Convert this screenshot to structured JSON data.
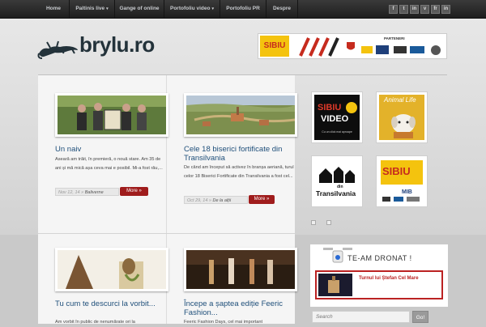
{
  "nav": {
    "items": [
      {
        "label": "Home",
        "has_arrow": false
      },
      {
        "label": "Paltinis live",
        "has_arrow": true
      },
      {
        "label": "Gange of online",
        "has_arrow": false
      },
      {
        "label": "Portofoliu video",
        "has_arrow": true
      },
      {
        "label": "Portofoliu PR",
        "has_arrow": false
      },
      {
        "label": "Despre",
        "has_arrow": false
      }
    ],
    "social": [
      "f",
      "t",
      "in",
      "v",
      "fr",
      "in"
    ]
  },
  "logo": {
    "text": "brylu.ro",
    "icon": "gecko-icon"
  },
  "banner": {
    "sibiu": "SIBIU",
    "parteneri": "PARTENERI"
  },
  "posts": [
    {
      "title": "Un naiv",
      "excerpt": "Aseară am trăit, în premieră, o nouă stare. Am 35 de ani și mă mică așa ceva mai e posibil. Mi-a fost râu,...",
      "date": "Nov 12, 14",
      "category": "Baliverne",
      "more": "More »"
    },
    {
      "title": "Cele 18 biserici fortificate din Transilvania",
      "excerpt": "De când am început să activez în branșa aeriană, turul celor 18 Biserici Fortificate din Transilvania a fost cel...",
      "date": "Oct 29, 14",
      "category": "De la alții",
      "more": "More »"
    },
    {
      "title": "Tu cum te descurci la vorbit...",
      "excerpt": "Am vorbit în public de nenumărate ori la",
      "date": "",
      "category": "",
      "more": ""
    },
    {
      "title": "Începe a șaptea ediție Feeric Fashion...",
      "excerpt": "Feeric Fashion Days, cel mai important",
      "date": "",
      "category": "",
      "more": ""
    }
  ],
  "sidebar": {
    "tiles": [
      {
        "line1": "SIBIU",
        "line2": "VIDEO",
        "caption": "Cu un click mai aproape"
      },
      {
        "line1": "Animal Life"
      },
      {
        "line1": "din",
        "line2": "Transilvania"
      },
      {
        "line1": "SIBIU",
        "line2": "MIB"
      }
    ],
    "dronat": {
      "title": "TE-AM DRONAT !",
      "link": "Turnul lui Ștefan Cel Mare"
    },
    "search": {
      "placeholder": "Search",
      "button": "Go!"
    }
  }
}
